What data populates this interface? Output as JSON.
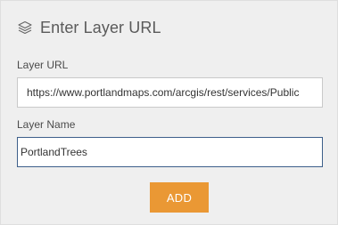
{
  "dialog": {
    "title": "Enter Layer URL",
    "icon": "layers-icon"
  },
  "layer_url": {
    "label": "Layer URL",
    "value": "https://www.portlandmaps.com/arcgis/rest/services/Public"
  },
  "layer_name": {
    "label": "Layer Name",
    "value": "PortlandTrees"
  },
  "actions": {
    "add_label": "ADD"
  },
  "colors": {
    "panel_background": "#efefef",
    "accent": "#ea9834",
    "focus_border": "#3d5f8a"
  }
}
